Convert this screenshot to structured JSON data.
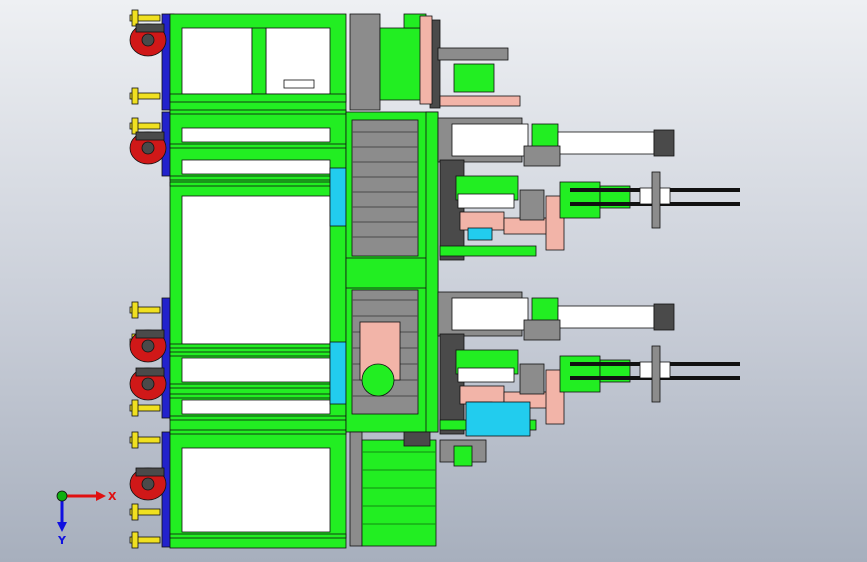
{
  "viewport": {
    "background_top": "#eef0f3",
    "background_bottom": "#a7afbd"
  },
  "colors": {
    "frame_green": "#22ee22",
    "frame_dark": "#128a12",
    "panel_white": "#ffffff",
    "side_blue": "#2222cc",
    "leveler_yellow": "#f0e020",
    "caster_red": "#d01818",
    "plate_salmon": "#f2b4a8",
    "metal_grey": "#8c8c8c",
    "metal_dark": "#4a4a4a",
    "cyan_block": "#22ccee",
    "outline": "#111111"
  },
  "triad": {
    "x_label": "X",
    "y_label": "Y",
    "x_color": "#e01010",
    "y_color": "#1010e0",
    "origin_color": "#10b010"
  },
  "parts": {
    "main_frame": "machine-frame",
    "casters": "caster-wheel",
    "levelers": "leveling-foot"
  }
}
